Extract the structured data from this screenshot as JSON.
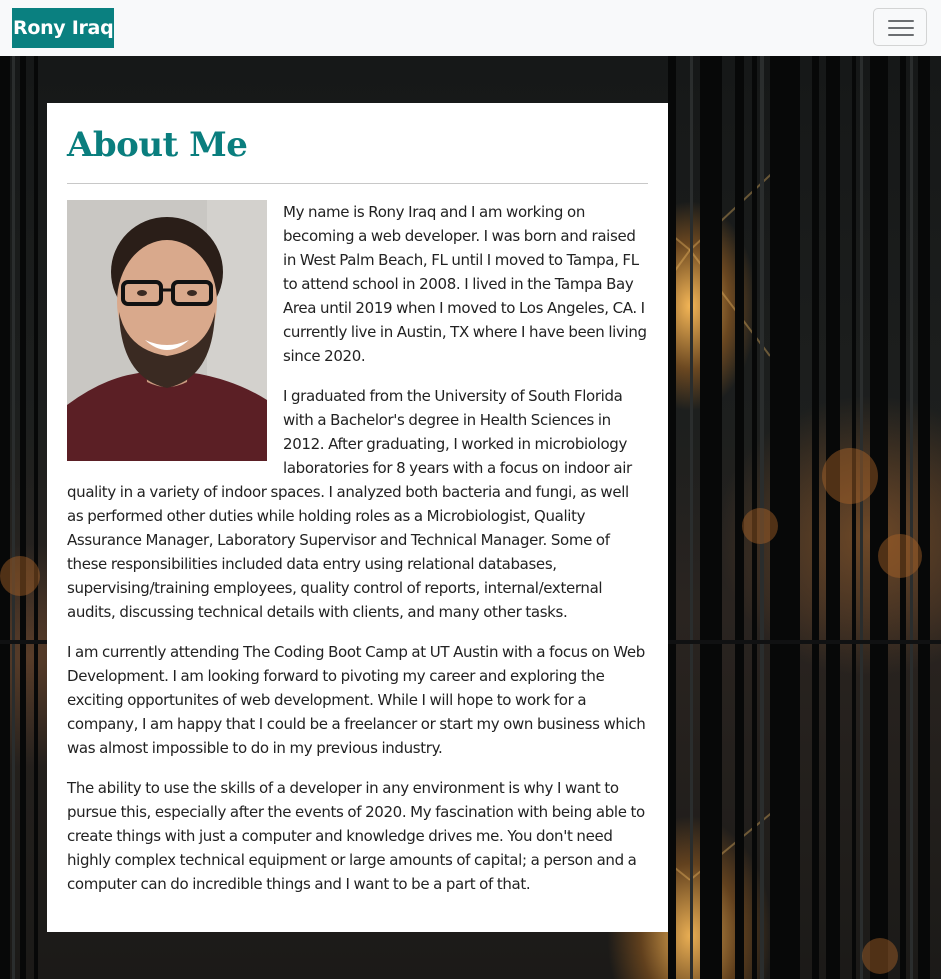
{
  "navbar": {
    "brand": "Rony Iraq",
    "toggler_icon": "hamburger-menu-icon"
  },
  "about": {
    "heading": "About Me",
    "photo_icon": "profile-photo",
    "paragraphs": [
      "My name is Rony Iraq and I am working on becoming a web developer. I was born and raised in West Palm Beach, FL until I moved to Tampa, FL to attend school in 2008. I lived in the Tampa Bay Area until 2019 when I moved to Los Angeles, CA. I currently live in Austin, TX where I have been living since 2020.",
      "I graduated from the University of South Florida with a Bachelor's degree in Health Sciences in 2012. After graduating, I worked in microbiology laboratories for 8 years with a focus on indoor air quality in a variety of indoor spaces. I analyzed both bacteria and fungi, as well as performed other duties while holding roles as a Microbiologist, Quality Assurance Manager, Laboratory Supervisor and Technical Manager. Some of these responsibilities included data entry using relational databases, supervising/training employees, quality control of reports, internal/external audits, discussing technical details with clients, and many other tasks.",
      "I am currently attending The Coding Boot Camp at UT Austin with a focus on Web Development. I am looking forward to pivoting my career and exploring the exciting opportunites of web development. While I will hope to work for a company, I am happy that I could be a freelancer or start my own business which was almost impossible to do in my previous industry.",
      "The ability to use the skills of a developer in any environment is why I want to pursue this, especially after the events of 2020. My fascination with being able to create things with just a computer and knowledge drives me. You don't need highly complex technical equipment or large amounts of capital; a person and a computer can do incredible things and I want to be a part of that."
    ]
  },
  "colors": {
    "brand_bg": "#0a8080",
    "heading": "#0a7e7e",
    "navbar_bg": "#f8f9fa"
  }
}
